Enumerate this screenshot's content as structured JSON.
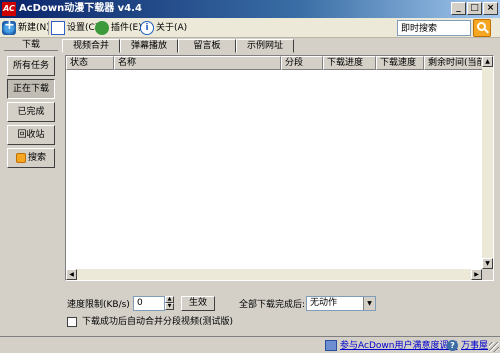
{
  "window": {
    "title": "AcDown动漫下载器 v4.4",
    "icon_text": "AC",
    "controls": [
      "_",
      "□",
      "×"
    ]
  },
  "toolbar": {
    "new_label": "新建(N)",
    "settings_label": "设置(C)",
    "plugin_label": "插件(E)",
    "about_label": "关于(A)",
    "search_label": "即时搜索",
    "search_value": ""
  },
  "sidebar": {
    "title": "下载",
    "items": [
      {
        "label": "所有任务"
      },
      {
        "label": "正在下载"
      },
      {
        "label": "已完成"
      },
      {
        "label": "回收站"
      },
      {
        "label": "搜索"
      }
    ]
  },
  "tabs": [
    {
      "label": "视频合并"
    },
    {
      "label": "弹幕播放"
    },
    {
      "label": "留言板"
    },
    {
      "label": "示例网址"
    }
  ],
  "list": {
    "columns": [
      "状态",
      "名称",
      "分段",
      "下载进度",
      "下载速度",
      "剩余时间(当前分"
    ],
    "rows": []
  },
  "controls": {
    "speed_label": "速度限制(KB/s)",
    "speed_value": "0",
    "apply_label": "生效",
    "done_label": "全部下载完成后:",
    "done_value": "无动作",
    "merge_label": "下载成功后自动合并分段视频(测试版)",
    "merge_checked": false
  },
  "status": {
    "survey_link": "参与AcDown用户满意度调查",
    "help_link": "万事屋"
  }
}
